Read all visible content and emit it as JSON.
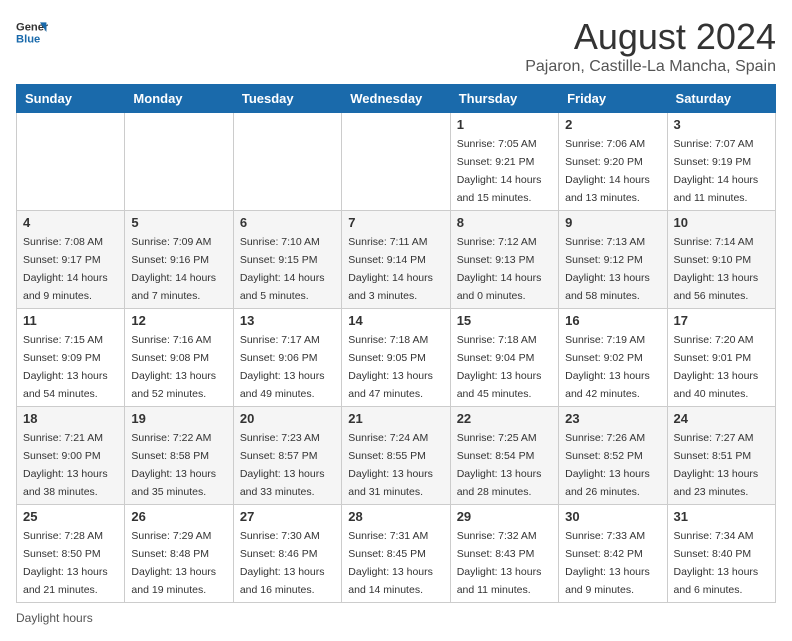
{
  "header": {
    "logo_line1": "General",
    "logo_line2": "Blue",
    "month_title": "August 2024",
    "location": "Pajaron, Castille-La Mancha, Spain"
  },
  "weekdays": [
    "Sunday",
    "Monday",
    "Tuesday",
    "Wednesday",
    "Thursday",
    "Friday",
    "Saturday"
  ],
  "footer_text": "Daylight hours",
  "weeks": [
    [
      {
        "day": "",
        "info": ""
      },
      {
        "day": "",
        "info": ""
      },
      {
        "day": "",
        "info": ""
      },
      {
        "day": "",
        "info": ""
      },
      {
        "day": "1",
        "info": "Sunrise: 7:05 AM\nSunset: 9:21 PM\nDaylight: 14 hours\nand 15 minutes."
      },
      {
        "day": "2",
        "info": "Sunrise: 7:06 AM\nSunset: 9:20 PM\nDaylight: 14 hours\nand 13 minutes."
      },
      {
        "day": "3",
        "info": "Sunrise: 7:07 AM\nSunset: 9:19 PM\nDaylight: 14 hours\nand 11 minutes."
      }
    ],
    [
      {
        "day": "4",
        "info": "Sunrise: 7:08 AM\nSunset: 9:17 PM\nDaylight: 14 hours\nand 9 minutes."
      },
      {
        "day": "5",
        "info": "Sunrise: 7:09 AM\nSunset: 9:16 PM\nDaylight: 14 hours\nand 7 minutes."
      },
      {
        "day": "6",
        "info": "Sunrise: 7:10 AM\nSunset: 9:15 PM\nDaylight: 14 hours\nand 5 minutes."
      },
      {
        "day": "7",
        "info": "Sunrise: 7:11 AM\nSunset: 9:14 PM\nDaylight: 14 hours\nand 3 minutes."
      },
      {
        "day": "8",
        "info": "Sunrise: 7:12 AM\nSunset: 9:13 PM\nDaylight: 14 hours\nand 0 minutes."
      },
      {
        "day": "9",
        "info": "Sunrise: 7:13 AM\nSunset: 9:12 PM\nDaylight: 13 hours\nand 58 minutes."
      },
      {
        "day": "10",
        "info": "Sunrise: 7:14 AM\nSunset: 9:10 PM\nDaylight: 13 hours\nand 56 minutes."
      }
    ],
    [
      {
        "day": "11",
        "info": "Sunrise: 7:15 AM\nSunset: 9:09 PM\nDaylight: 13 hours\nand 54 minutes."
      },
      {
        "day": "12",
        "info": "Sunrise: 7:16 AM\nSunset: 9:08 PM\nDaylight: 13 hours\nand 52 minutes."
      },
      {
        "day": "13",
        "info": "Sunrise: 7:17 AM\nSunset: 9:06 PM\nDaylight: 13 hours\nand 49 minutes."
      },
      {
        "day": "14",
        "info": "Sunrise: 7:18 AM\nSunset: 9:05 PM\nDaylight: 13 hours\nand 47 minutes."
      },
      {
        "day": "15",
        "info": "Sunrise: 7:18 AM\nSunset: 9:04 PM\nDaylight: 13 hours\nand 45 minutes."
      },
      {
        "day": "16",
        "info": "Sunrise: 7:19 AM\nSunset: 9:02 PM\nDaylight: 13 hours\nand 42 minutes."
      },
      {
        "day": "17",
        "info": "Sunrise: 7:20 AM\nSunset: 9:01 PM\nDaylight: 13 hours\nand 40 minutes."
      }
    ],
    [
      {
        "day": "18",
        "info": "Sunrise: 7:21 AM\nSunset: 9:00 PM\nDaylight: 13 hours\nand 38 minutes."
      },
      {
        "day": "19",
        "info": "Sunrise: 7:22 AM\nSunset: 8:58 PM\nDaylight: 13 hours\nand 35 minutes."
      },
      {
        "day": "20",
        "info": "Sunrise: 7:23 AM\nSunset: 8:57 PM\nDaylight: 13 hours\nand 33 minutes."
      },
      {
        "day": "21",
        "info": "Sunrise: 7:24 AM\nSunset: 8:55 PM\nDaylight: 13 hours\nand 31 minutes."
      },
      {
        "day": "22",
        "info": "Sunrise: 7:25 AM\nSunset: 8:54 PM\nDaylight: 13 hours\nand 28 minutes."
      },
      {
        "day": "23",
        "info": "Sunrise: 7:26 AM\nSunset: 8:52 PM\nDaylight: 13 hours\nand 26 minutes."
      },
      {
        "day": "24",
        "info": "Sunrise: 7:27 AM\nSunset: 8:51 PM\nDaylight: 13 hours\nand 23 minutes."
      }
    ],
    [
      {
        "day": "25",
        "info": "Sunrise: 7:28 AM\nSunset: 8:50 PM\nDaylight: 13 hours\nand 21 minutes."
      },
      {
        "day": "26",
        "info": "Sunrise: 7:29 AM\nSunset: 8:48 PM\nDaylight: 13 hours\nand 19 minutes."
      },
      {
        "day": "27",
        "info": "Sunrise: 7:30 AM\nSunset: 8:46 PM\nDaylight: 13 hours\nand 16 minutes."
      },
      {
        "day": "28",
        "info": "Sunrise: 7:31 AM\nSunset: 8:45 PM\nDaylight: 13 hours\nand 14 minutes."
      },
      {
        "day": "29",
        "info": "Sunrise: 7:32 AM\nSunset: 8:43 PM\nDaylight: 13 hours\nand 11 minutes."
      },
      {
        "day": "30",
        "info": "Sunrise: 7:33 AM\nSunset: 8:42 PM\nDaylight: 13 hours\nand 9 minutes."
      },
      {
        "day": "31",
        "info": "Sunrise: 7:34 AM\nSunset: 8:40 PM\nDaylight: 13 hours\nand 6 minutes."
      }
    ]
  ]
}
